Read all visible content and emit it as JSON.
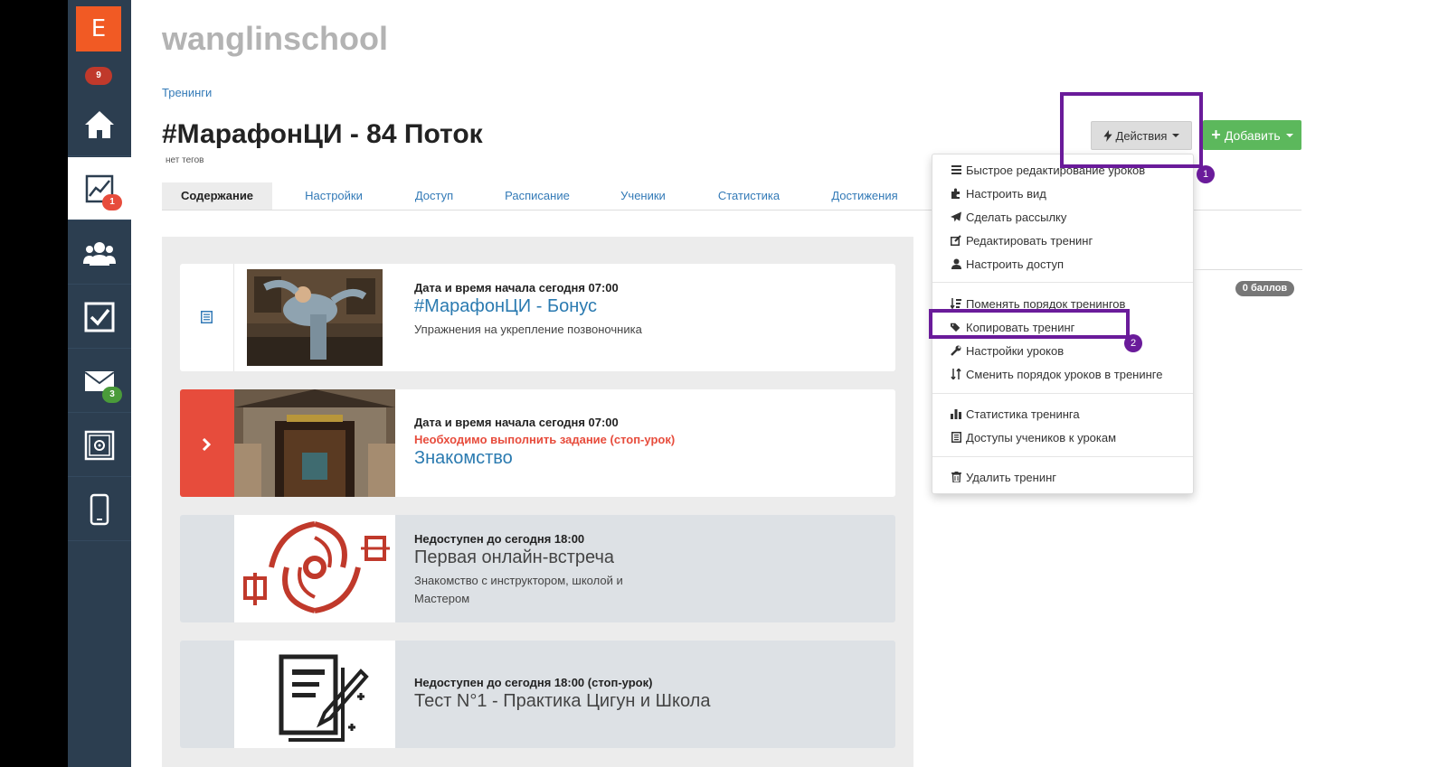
{
  "sidebar": {
    "logo_letter": "E",
    "notification_count": "9",
    "badges": {
      "trainings": "1",
      "messages": "3"
    }
  },
  "header": {
    "school_name": "wanglinschool",
    "breadcrumb": "Тренинги",
    "title": "#МарафонЦИ - 84 Поток",
    "tags": "нет тегов"
  },
  "tabs": [
    "Содержание",
    "Настройки",
    "Доступ",
    "Расписание",
    "Ученики",
    "Статистика",
    "Достижения"
  ],
  "toolbar": {
    "actions_label": "Действия",
    "add_label": "Добавить"
  },
  "dropdown": {
    "items": [
      {
        "label": "Быстрое редактирование уроков",
        "icon": "bars-icon"
      },
      {
        "label": "Настроить вид",
        "icon": "puzzle-icon"
      },
      {
        "label": "Сделать рассылку",
        "icon": "paper-plane-icon"
      },
      {
        "label": "Редактировать тренинг",
        "icon": "edit-icon"
      },
      {
        "label": "Настроить доступ",
        "icon": "user-icon"
      },
      {
        "label": "Поменять порядок тренингов",
        "icon": "sort-icon"
      },
      {
        "label": "Копировать тренинг",
        "icon": "tags-icon"
      },
      {
        "label": "Настройки уроков",
        "icon": "wrench-icon"
      },
      {
        "label": "Сменить порядок уроков в тренинге",
        "icon": "sort-vertical-icon"
      },
      {
        "label": "Статистика тренинга",
        "icon": "bar-chart-icon"
      },
      {
        "label": "Доступы учеников к урокам",
        "icon": "list-icon"
      },
      {
        "label": "Удалить тренинг",
        "icon": "trash-icon"
      }
    ]
  },
  "annotations": {
    "first": "1",
    "second": "2"
  },
  "points_badge": "0 баллов",
  "lessons": [
    {
      "date": "Дата и время начала сегодня 07:00",
      "title": "#МарафонЦИ - Бонус",
      "desc": "Упражнения на укрепление позвоночника"
    },
    {
      "date": "Дата и время начала сегодня 07:00",
      "stop_note": "Необходимо выполнить задание (стоп-урок)",
      "title": "Знакомство"
    },
    {
      "date": "Недоступен до сегодня 18:00",
      "title": "Первая онлайн-встреча",
      "desc": "Знакомство с инструктором, школой и Мастером"
    },
    {
      "date": "Недоступен до сегодня 18:00 (стоп-урок)",
      "title": "Тест N°1 - Практика Цигун и Школа"
    }
  ],
  "colors": {
    "sidebar": "#2c3e50",
    "logo": "#f15a24",
    "highlight": "#6a1b9a",
    "add_button": "#5cb85c",
    "stop_red": "#e74c3c",
    "link_blue": "#337ab7"
  }
}
